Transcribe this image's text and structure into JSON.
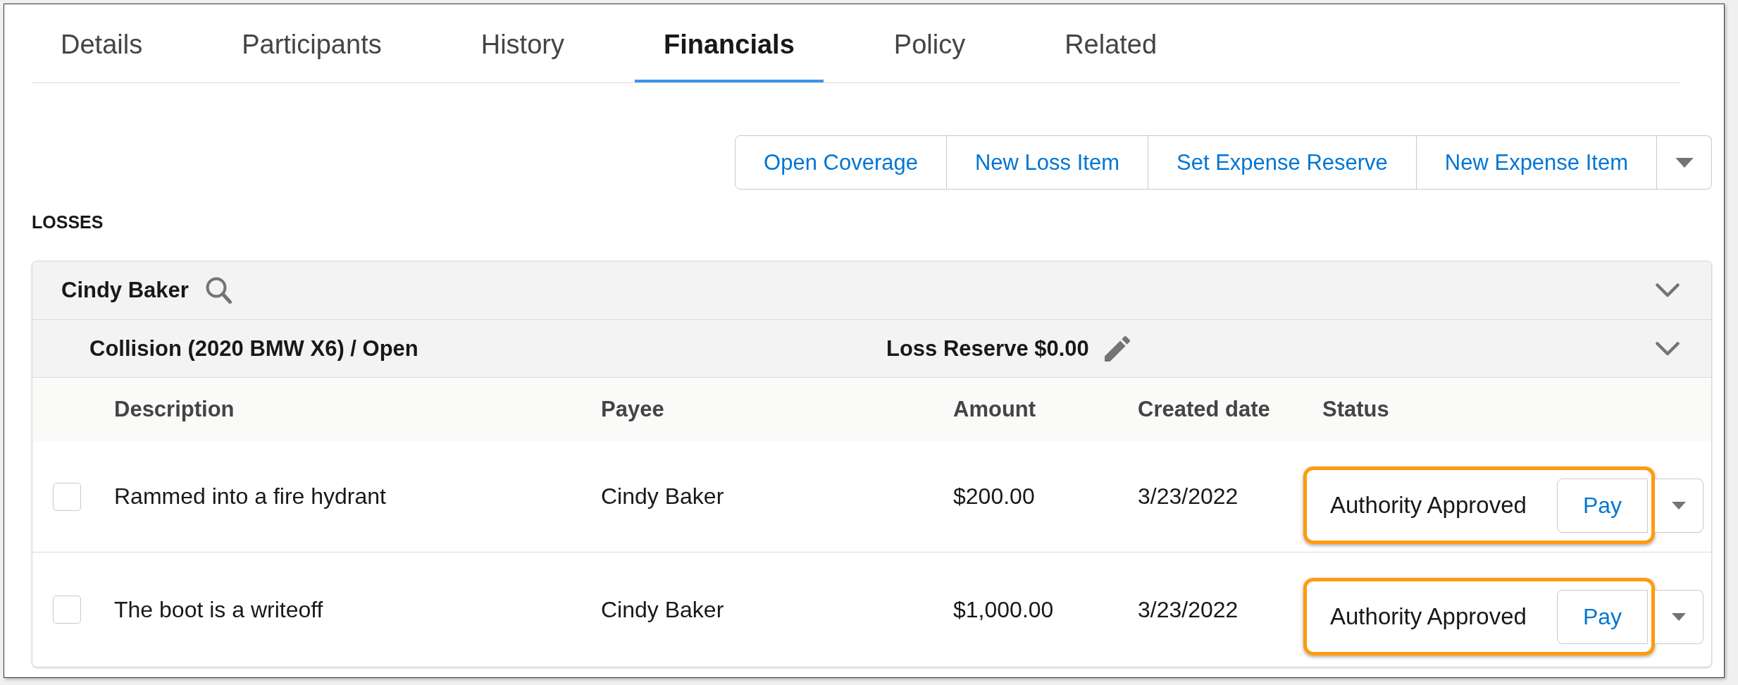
{
  "tabs": [
    {
      "label": "Details",
      "selected": false
    },
    {
      "label": "Participants",
      "selected": false
    },
    {
      "label": "History",
      "selected": false
    },
    {
      "label": "Financials",
      "selected": true
    },
    {
      "label": "Policy",
      "selected": false
    },
    {
      "label": "Related",
      "selected": false
    }
  ],
  "actions": {
    "buttons": [
      "Open Coverage",
      "New Loss Item",
      "Set Expense Reserve",
      "New Expense Item"
    ]
  },
  "losses": {
    "heading": "LOSSES",
    "claimant": {
      "name": "Cindy Baker"
    },
    "coverage": {
      "title": "Collision (2020 BMW X6) / Open",
      "reserve": "Loss Reserve $0.00"
    },
    "table": {
      "columns": [
        "Description",
        "Payee",
        "Amount",
        "Created date",
        "Status"
      ],
      "rows": [
        {
          "checked": false,
          "description": "Rammed into a fire hydrant",
          "payee": "Cindy Baker",
          "amount": "$200.00",
          "created_date": "3/23/2022",
          "status": "Authority Approved",
          "action": "Pay",
          "highlighted": true
        },
        {
          "checked": false,
          "description": "The boot is a writeoff",
          "payee": "Cindy Baker",
          "amount": "$1,000.00",
          "created_date": "3/23/2022",
          "status": "Authority Approved",
          "action": "Pay",
          "highlighted": true
        }
      ]
    }
  }
}
